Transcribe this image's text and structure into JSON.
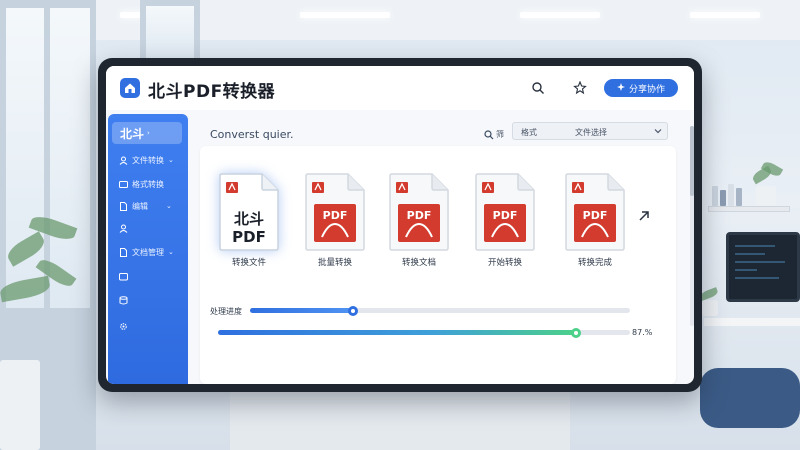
{
  "app": {
    "title": "北斗PDF转换器"
  },
  "header": {
    "icons": [
      "search-icon",
      "pin-icon"
    ],
    "action_button": {
      "label": "分享协作",
      "icon": "sparkle-icon"
    }
  },
  "sidebar": {
    "active_label": "北斗",
    "items": [
      {
        "label": "文件转换",
        "icon": "user-icon",
        "has_chevron": true
      },
      {
        "label": "格式转换",
        "icon": "card-icon",
        "has_chevron": false
      },
      {
        "label": "编辑",
        "icon": "doc-icon",
        "has_chevron": true
      },
      {
        "label": "",
        "icon": "user-icon",
        "has_chevron": false
      },
      {
        "label": "文档管理",
        "icon": "doc-icon",
        "has_chevron": true
      },
      {
        "label": "",
        "icon": "folder-icon",
        "has_chevron": false
      },
      {
        "label": "",
        "icon": "database-icon",
        "has_chevron": false
      },
      {
        "label": "",
        "icon": "gear-icon",
        "has_chevron": false
      }
    ]
  },
  "main": {
    "convert_label": "Converst quier.",
    "filter_label": "筛",
    "dropdown": {
      "option_a": "格式",
      "option_b": "文件选择"
    },
    "files": [
      {
        "label": "转换文件",
        "badge": "北斗\nPDF",
        "variant": "brand"
      },
      {
        "label": "批量转换",
        "badge": "PDF",
        "variant": "pdf"
      },
      {
        "label": "转换文档",
        "badge": "PDF",
        "variant": "pdf"
      },
      {
        "label": "开始转换",
        "badge": "PDF",
        "variant": "pdf"
      },
      {
        "label": "转换完成",
        "badge": "PDF",
        "variant": "pdf"
      }
    ],
    "progress_label": "处理进度",
    "progress": [
      {
        "name": "upload",
        "value": 0.27
      },
      {
        "name": "convert",
        "value": 0.87
      }
    ],
    "percent_text": "87.%"
  },
  "colors": {
    "accent": "#2f6fe0",
    "pdf_red": "#d23b2e",
    "progress_green": "#4cd08a"
  }
}
